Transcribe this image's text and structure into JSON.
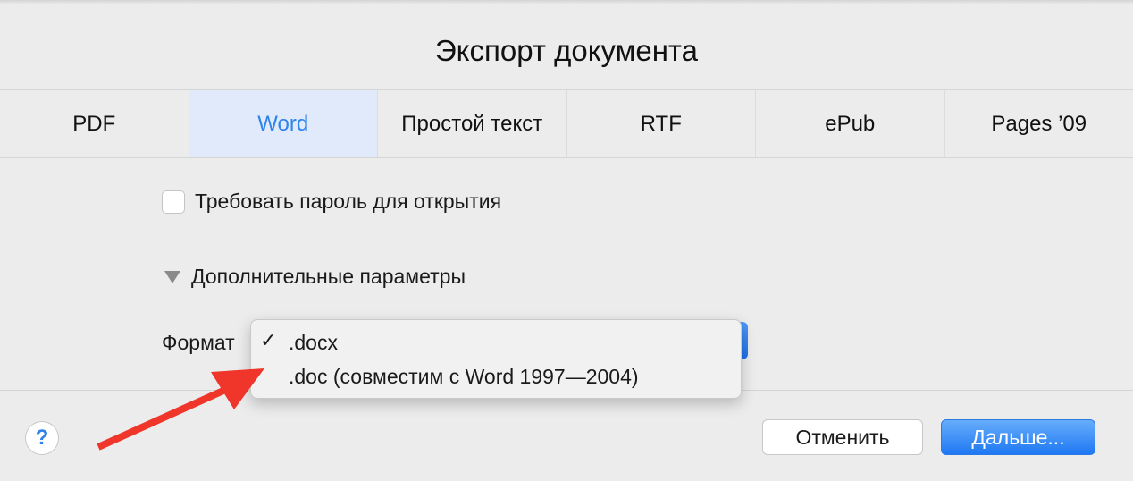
{
  "dialog": {
    "title": "Экспорт документа",
    "tabs": [
      {
        "label": "PDF",
        "active": false
      },
      {
        "label": "Word",
        "active": true
      },
      {
        "label": "Простой текст",
        "active": false
      },
      {
        "label": "RTF",
        "active": false
      },
      {
        "label": "ePub",
        "active": false
      },
      {
        "label": "Pages ’09",
        "active": false
      }
    ],
    "password_checkbox": {
      "label": "Требовать пароль для открытия",
      "checked": false
    },
    "advanced": {
      "label": "Дополнительные параметры",
      "expanded": true
    },
    "format": {
      "label": "Формат",
      "options": [
        {
          "check": "✓",
          "label": ".docx",
          "selected": true
        },
        {
          "check": "",
          "label": ".doc (совместим с Word 1997—2004)",
          "selected": false
        }
      ]
    },
    "help_icon": "?",
    "buttons": {
      "cancel": "Отменить",
      "next": "Дальше..."
    }
  },
  "annotation": {
    "type": "arrow",
    "color": "#f0352a",
    "points_to": ".doc (совместим с Word 1997—2004)"
  }
}
